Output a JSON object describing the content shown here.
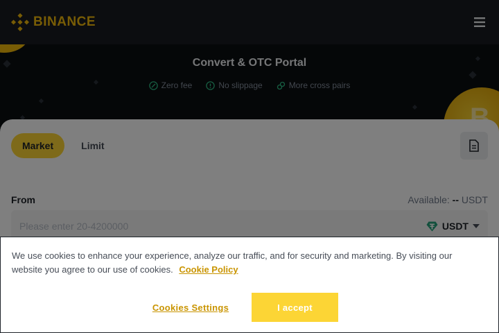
{
  "header": {
    "logo_text": "BINANCE",
    "logo_icon": "binance-diamond-icon",
    "menu_icon": "hamburger-menu-icon"
  },
  "hero": {
    "title": "Convert & OTC Portal",
    "features": [
      {
        "label": "Zero fee",
        "icon": "percent-icon"
      },
      {
        "label": "No slippage",
        "icon": "alert-circle-icon"
      },
      {
        "label": "More cross pairs",
        "icon": "link-icon"
      }
    ]
  },
  "convert": {
    "tabs": [
      {
        "label": "Market",
        "active": true
      },
      {
        "label": "Limit",
        "active": false
      }
    ],
    "history_icon": "document-icon",
    "from_label": "From",
    "available_prefix": "Available:",
    "available_value": "--",
    "available_unit": "USDT",
    "amount_placeholder": "Please enter 20-4200000",
    "coin": "USDT",
    "coin_icon": "tether-icon"
  },
  "cookie_banner": {
    "text": "We use cookies to enhance your experience, analyze our traffic, and for security and marketing. By visiting our website you agree to our use of cookies.",
    "policy_link": "Cookie Policy",
    "settings_button": "Cookies Settings",
    "accept_button": "I accept"
  },
  "colors": {
    "brand": "#f0b90b",
    "accent_yellow": "#fcd535",
    "link_gold": "#c99400",
    "dark_bg": "#0b0e11",
    "header_bg": "#181a20",
    "tether_green": "#26a17b"
  }
}
